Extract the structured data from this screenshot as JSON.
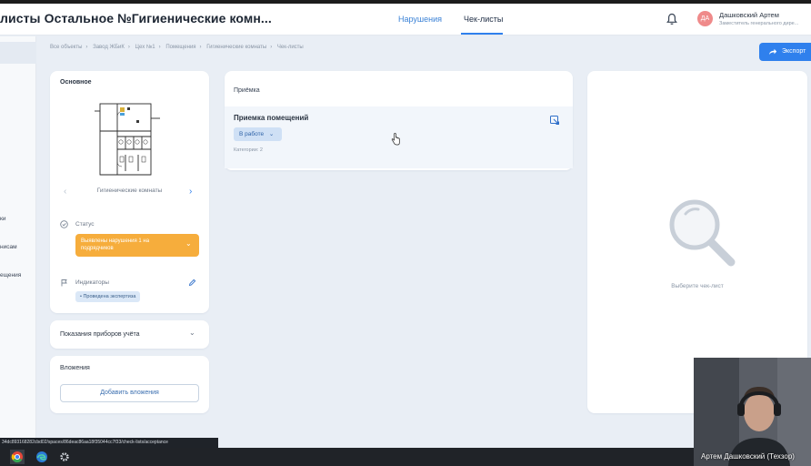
{
  "header": {
    "title": "листы Остальное №Гигиенические комн...",
    "tabs": [
      {
        "label": "Нарушения",
        "active": false
      },
      {
        "label": "Чек-листы",
        "active": true
      }
    ],
    "bell_icon": "bell-icon",
    "user": {
      "initials": "ДА",
      "name": "Дашковский Артем",
      "role": "Заместитель генерального дире..."
    }
  },
  "sidebar": {
    "items": [
      {
        "label": "ки"
      },
      {
        "label": "нисам"
      },
      {
        "label": "ещения"
      }
    ]
  },
  "breadcrumb": [
    "Все объекты",
    "Завод ЖБиК",
    "Цех №1",
    "Помещения",
    "Гигиенические комнаты",
    "Чек-листы"
  ],
  "export_label": "Экспорт",
  "object_card": {
    "title": "Основное",
    "plan_caption": "Гигиенические комнаты",
    "status_label": "Статус",
    "status_value": "Выявлены нарушения 1 на подрядчиков",
    "indicators_label": "Индикаторы",
    "indicator_tag": "Проведена экспертиза"
  },
  "meters": {
    "title": "Показания приборов учёта"
  },
  "attachments": {
    "title": "Вложения",
    "add_label": "Добавить вложения"
  },
  "checklists": {
    "section_title": "Приёмка",
    "item": {
      "title": "Приемка помещений",
      "status": "В работе",
      "categories": "Категории: 2"
    }
  },
  "empty_state": {
    "text": "Выберите чек-лист"
  },
  "status_bar": {
    "url": "34dc893168282cbd02/spaces/86deac86aa18f35044cc7f33/check-lists/acceptance"
  },
  "webcam": {
    "caption": "Артем Дашковский (Техзор)"
  },
  "colors": {
    "accent": "#2f80ed",
    "status_warning": "#f6ad3c",
    "badge_bg": "#cfe0f5"
  }
}
